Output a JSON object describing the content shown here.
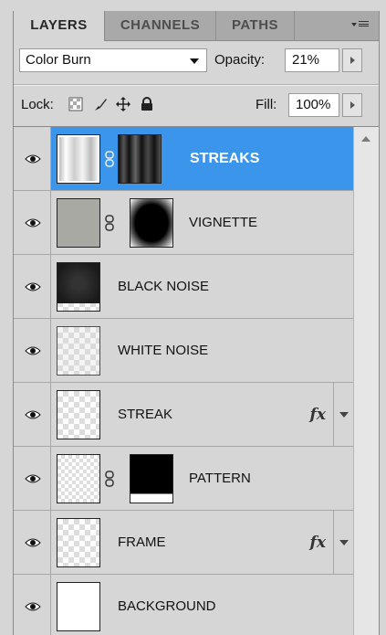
{
  "tabs": [
    {
      "label": "LAYERS",
      "active": true
    },
    {
      "label": "CHANNELS",
      "active": false
    },
    {
      "label": "PATHS",
      "active": false
    }
  ],
  "blend_mode": "Color Burn",
  "opacity": {
    "label": "Opacity:",
    "value": "21%"
  },
  "lock": {
    "label": "Lock:"
  },
  "fill": {
    "label": "Fill:",
    "value": "100%"
  },
  "layers": [
    {
      "name": "STREAKS",
      "selected": true,
      "has_mask": true,
      "fx": false
    },
    {
      "name": "VIGNETTE",
      "selected": false,
      "has_mask": true,
      "fx": false
    },
    {
      "name": "BLACK NOISE",
      "selected": false,
      "has_mask": false,
      "fx": false
    },
    {
      "name": "WHITE NOISE",
      "selected": false,
      "has_mask": false,
      "fx": false
    },
    {
      "name": "STREAK",
      "selected": false,
      "has_mask": false,
      "fx": true
    },
    {
      "name": "PATTERN",
      "selected": false,
      "has_mask": true,
      "fx": false
    },
    {
      "name": "FRAME",
      "selected": false,
      "has_mask": false,
      "fx": true
    },
    {
      "name": "BACKGROUND",
      "selected": false,
      "has_mask": false,
      "fx": false
    }
  ],
  "fx_label": "fx",
  "colors": {
    "selection": "#3b95ea",
    "panel": "#d6d6d6",
    "tabbar": "#a9a9a9"
  }
}
